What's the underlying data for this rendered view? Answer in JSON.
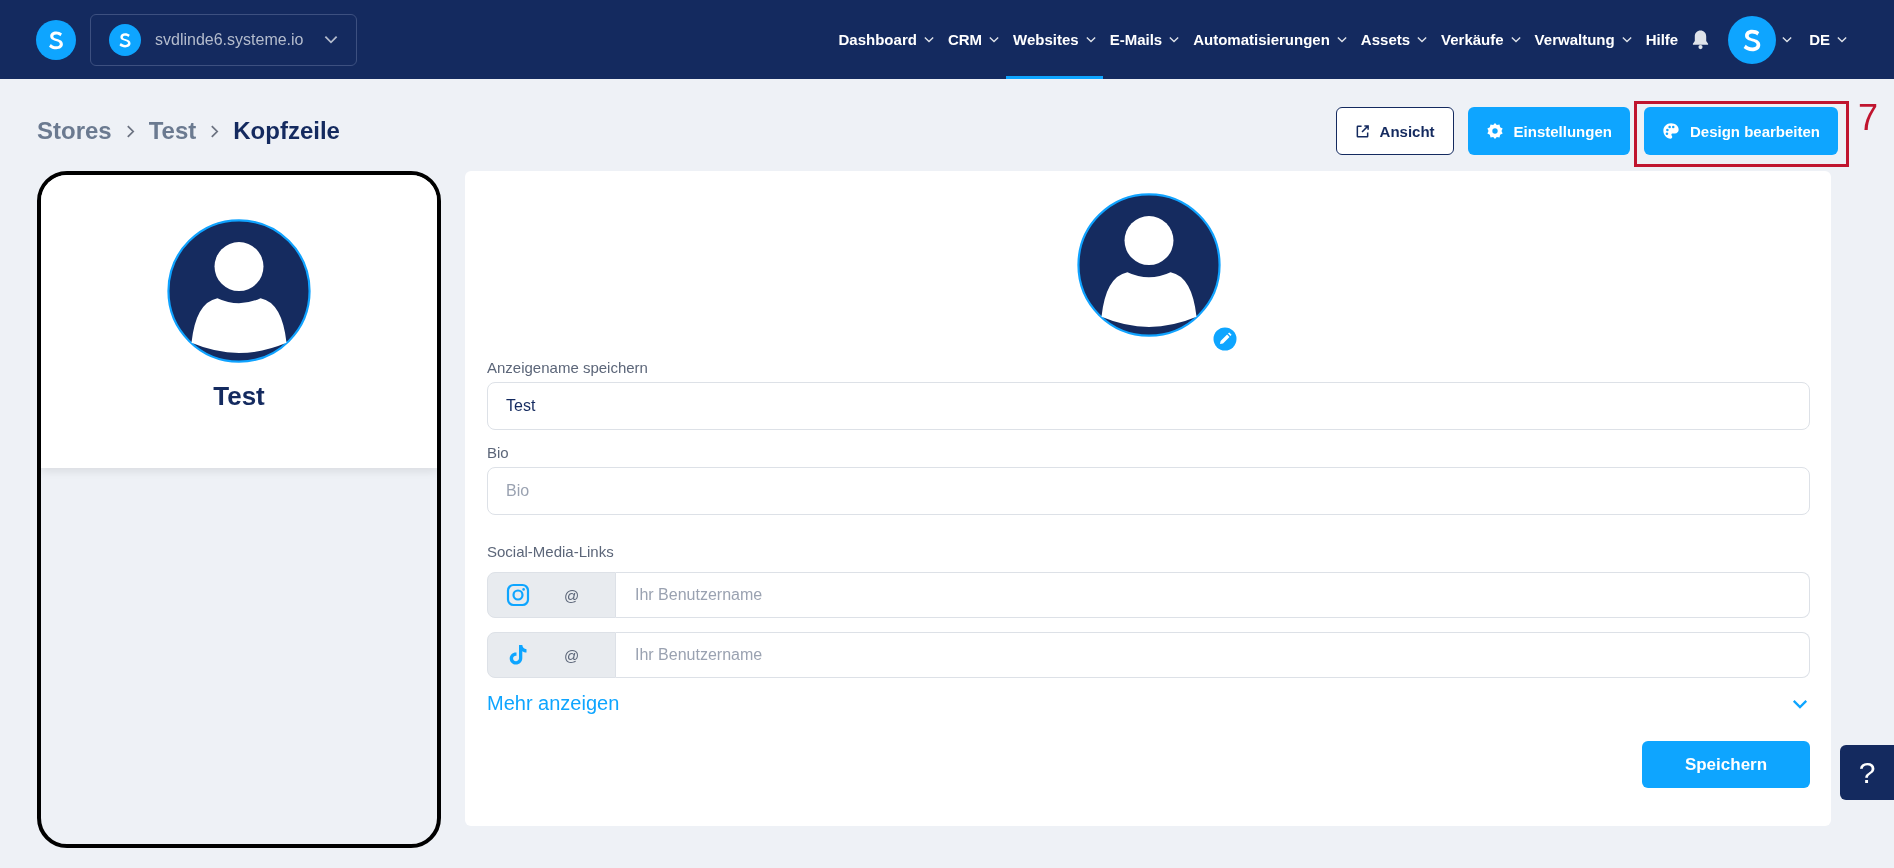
{
  "header": {
    "workspace": "svdlinde6.systeme.io",
    "nav": [
      {
        "label": "Dashboard",
        "selected": false,
        "has_menu": true
      },
      {
        "label": "CRM",
        "selected": false,
        "has_menu": true
      },
      {
        "label": "Websites",
        "selected": true,
        "has_menu": true
      },
      {
        "label": "E-Mails",
        "selected": false,
        "has_menu": true
      },
      {
        "label": "Automatisierungen",
        "selected": false,
        "has_menu": true
      },
      {
        "label": "Assets",
        "selected": false,
        "has_menu": true
      },
      {
        "label": "Verkäufe",
        "selected": false,
        "has_menu": true
      },
      {
        "label": "Verwaltung",
        "selected": false,
        "has_menu": true
      },
      {
        "label": "Hilfe",
        "selected": false,
        "has_menu": false
      }
    ],
    "language": "DE"
  },
  "breadcrumb": [
    "Stores",
    "Test",
    "Kopfzeile"
  ],
  "actions": [
    {
      "label": "Ansicht",
      "kind": "outline"
    },
    {
      "label": "Einstellungen",
      "kind": "primary"
    },
    {
      "label": "Design bearbeiten",
      "kind": "primary",
      "annotation": "7"
    }
  ],
  "preview": {
    "name": "Test"
  },
  "form": {
    "display_name": {
      "label": "Anzeigename speichern",
      "value": "Test"
    },
    "bio": {
      "label": "Bio",
      "placeholder": "Bio"
    },
    "social": {
      "label": "Social-Media-Links",
      "links": [
        {
          "kind": "instagram",
          "prefix": "@",
          "placeholder": "Ihr Benutzername"
        },
        {
          "kind": "tiktok",
          "prefix": "@",
          "placeholder": "Ihr Benutzername"
        }
      ]
    },
    "more": "Mehr anzeigen",
    "save": "Speichern"
  },
  "help": "?"
}
